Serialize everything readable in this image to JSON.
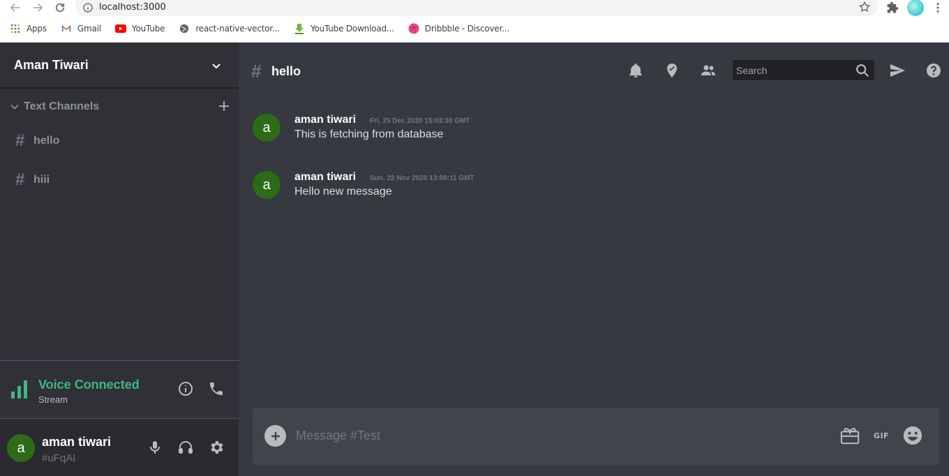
{
  "browser": {
    "url": "localhost:3000",
    "bookmarks": [
      {
        "label": "Apps",
        "icon": "apps-grid-icon"
      },
      {
        "label": "Gmail",
        "icon": "gmail-icon"
      },
      {
        "label": "YouTube",
        "icon": "youtube-icon"
      },
      {
        "label": "react-native-vector...",
        "icon": "globe-icon"
      },
      {
        "label": "YouTube Download...",
        "icon": "download-icon"
      },
      {
        "label": "Dribbble - Discover...",
        "icon": "dribbble-icon"
      }
    ]
  },
  "server": {
    "name": "Aman Tiwari",
    "category": "Text Channels",
    "channels": [
      {
        "name": "hello"
      },
      {
        "name": "hiii"
      }
    ]
  },
  "voice": {
    "status": "Voice Connected",
    "sub": "Stream"
  },
  "user": {
    "avatar_letter": "a",
    "name": "aman tiwari",
    "tag": "#uFqAI"
  },
  "chat": {
    "hash": "#",
    "channel": "hello",
    "search_placeholder": "Search",
    "messages": [
      {
        "avatar_letter": "a",
        "author": "aman tiwari",
        "time": "Fri, 25 Dec 2020 15:03:30 GMT",
        "text": "This is fetching from database"
      },
      {
        "avatar_letter": "a",
        "author": "aman tiwari",
        "time": "Sun, 22 Nov 2020 13:09:11 GMT",
        "text": "Hello new message"
      }
    ],
    "composer_placeholder": "Message #Test",
    "gif_label": "GIF"
  },
  "colors": {
    "app_bg": "#36393f",
    "sidebar_bg": "#2f3136",
    "user_panel_bg": "#292b2f",
    "voice_green": "#43b581",
    "avatar_green": "#2d6b19"
  }
}
